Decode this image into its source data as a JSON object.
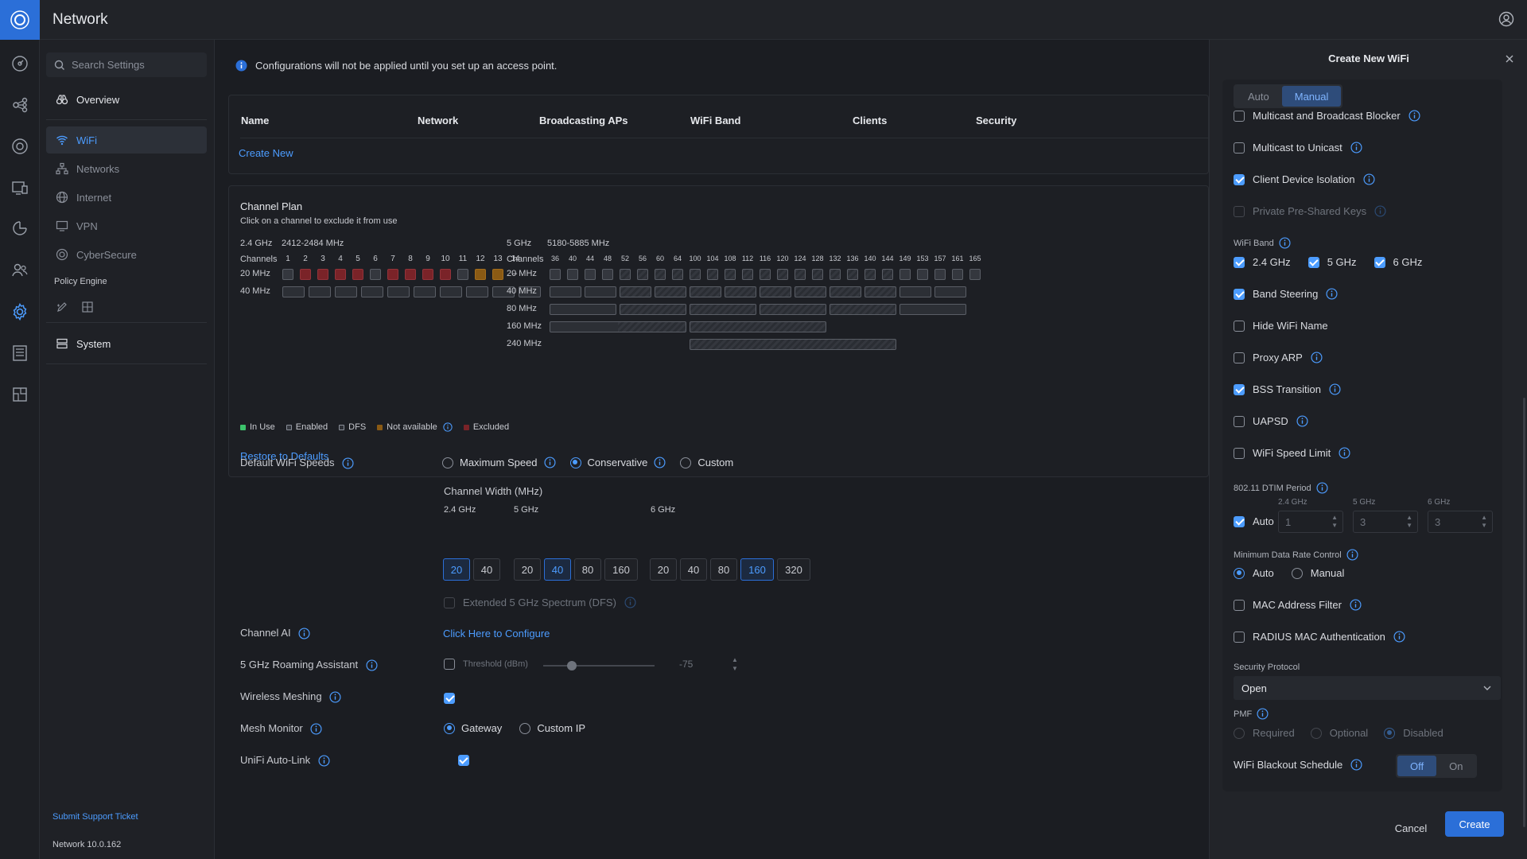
{
  "app": {
    "title": "Network"
  },
  "sidebar": {
    "search_placeholder": "Search Settings",
    "items": [
      {
        "label": "Overview"
      },
      {
        "label": "WiFi"
      },
      {
        "label": "Networks"
      },
      {
        "label": "Internet"
      },
      {
        "label": "VPN"
      },
      {
        "label": "CyberSecure"
      }
    ],
    "policy_engine": "Policy Engine",
    "system": "System",
    "support_link": "Submit Support Ticket",
    "version": "Network 10.0.162"
  },
  "banner": {
    "text": "Configurations will not be applied until you set up an access point."
  },
  "wifi_table": {
    "columns": [
      "Name",
      "Network",
      "Broadcasting APs",
      "WiFi Band",
      "Clients",
      "Security"
    ],
    "create_new": "Create New"
  },
  "channel_plan": {
    "title": "Channel Plan",
    "subtitle": "Click on a channel to exclude it from use",
    "band24": {
      "label": "2.4 GHz",
      "range": "2412-2484 MHz",
      "channels": [
        "1",
        "2",
        "3",
        "4",
        "5",
        "6",
        "7",
        "8",
        "9",
        "10",
        "11",
        "12",
        "13",
        "14"
      ],
      "dash": "–"
    },
    "band5": {
      "label": "5 GHz",
      "range": "5180-5885 MHz",
      "channels": [
        "36",
        "40",
        "44",
        "48",
        "52",
        "56",
        "60",
        "64",
        "100",
        "104",
        "108",
        "112",
        "116",
        "120",
        "124",
        "128",
        "132",
        "136",
        "140",
        "144",
        "149",
        "153",
        "157",
        "161",
        "165"
      ]
    },
    "row_labels": {
      "channels": "Channels",
      "w20": "20 MHz",
      "w40": "40 MHz",
      "w80": "80 MHz",
      "w160": "160 MHz",
      "w240": "240 MHz"
    },
    "legend": [
      "In Use",
      "Enabled",
      "DFS",
      "Not available",
      "Excluded"
    ],
    "restore": "Restore to Defaults"
  },
  "settings": {
    "default_speeds": {
      "label": "Default WiFi Speeds",
      "options": [
        "Maximum Speed",
        "Conservative",
        "Custom"
      ]
    },
    "channel_width": {
      "label": "Channel Width (MHz)",
      "b24": "2.4 GHz",
      "b5": "5 GHz",
      "b6": "6 GHz",
      "w24": [
        "20",
        "40"
      ],
      "w5": [
        "20",
        "40",
        "80",
        "160"
      ],
      "w6": [
        "20",
        "40",
        "80",
        "160",
        "320"
      ]
    },
    "extended_dfs": "Extended 5 GHz Spectrum (DFS)",
    "channel_ai": {
      "label": "Channel AI",
      "link": "Click Here to Configure"
    },
    "roaming": {
      "label": "5 GHz Roaming Assistant",
      "threshold": "Threshold (dBm)",
      "value": "-75"
    },
    "wireless_meshing": "Wireless Meshing",
    "mesh_monitor": {
      "label": "Mesh Monitor",
      "options": [
        "Gateway",
        "Custom IP"
      ]
    },
    "auto_link": "UniFi Auto-Link"
  },
  "panel": {
    "title": "Create New WiFi",
    "mode_tabs": [
      "Auto",
      "Manual"
    ],
    "options": [
      {
        "label": "Multicast and Broadcast Blocker"
      },
      {
        "label": "Multicast to Unicast"
      },
      {
        "label": "Client Device Isolation"
      },
      {
        "label": "Private Pre-Shared Keys"
      }
    ],
    "wifi_band": {
      "label": "WiFi Band",
      "bands": [
        "2.4 GHz",
        "5 GHz",
        "6 GHz"
      ]
    },
    "options2": [
      {
        "label": "Band Steering"
      },
      {
        "label": "Hide WiFi Name"
      },
      {
        "label": "Proxy ARP"
      },
      {
        "label": "BSS Transition"
      },
      {
        "label": "UAPSD"
      },
      {
        "label": "WiFi Speed Limit"
      }
    ],
    "dtim": {
      "label": "802.11 DTIM Period",
      "auto": "Auto",
      "bands": [
        "2.4 GHz",
        "5 GHz",
        "6 GHz"
      ],
      "values": [
        "1",
        "3",
        "3"
      ]
    },
    "min_rate": {
      "label": "Minimum Data Rate Control",
      "options": [
        "Auto",
        "Manual"
      ]
    },
    "mac_filter": "MAC Address Filter",
    "radius": "RADIUS MAC Authentication",
    "security": {
      "label": "Security Protocol",
      "value": "Open"
    },
    "pmf": {
      "label": "PMF",
      "options": [
        "Required",
        "Optional",
        "Disabled"
      ]
    },
    "blackout": {
      "label": "WiFi Blackout Schedule",
      "off": "Off",
      "on": "On"
    },
    "cancel": "Cancel",
    "create": "Create"
  }
}
